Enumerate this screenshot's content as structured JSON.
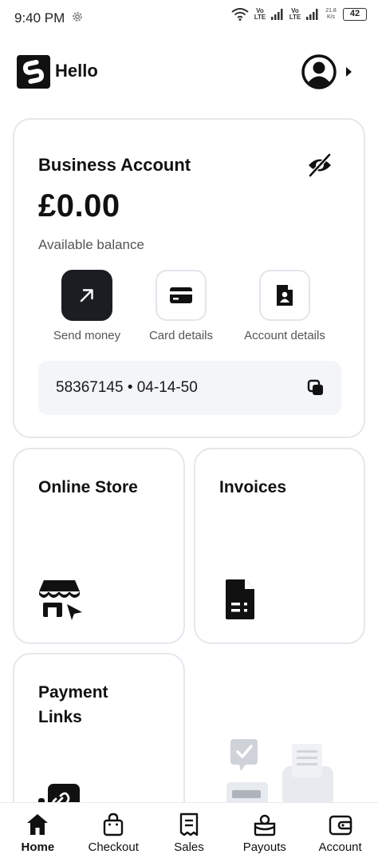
{
  "status_bar": {
    "time": "9:40 PM",
    "network_1": "Vo LTE",
    "network_2": "Vo LTE",
    "speed": "21.8 K/s",
    "battery": "42"
  },
  "header": {
    "greeting": "Hello"
  },
  "account_card": {
    "title": "Business Account",
    "balance": "£0.00",
    "balance_caption": "Available balance",
    "actions": [
      {
        "label": "Send money",
        "icon": "arrow-up-right-icon"
      },
      {
        "label": "Card details",
        "icon": "card-icon"
      },
      {
        "label": "Account details",
        "icon": "document-person-icon"
      }
    ],
    "account_number": "58367145 • 04-14-50"
  },
  "tiles": {
    "online_store": "Online Store",
    "invoices": "Invoices",
    "payment_links": "Payment Links"
  },
  "bottom_nav": [
    {
      "label": "Home",
      "icon": "home-icon",
      "active": true
    },
    {
      "label": "Checkout",
      "icon": "shopping-bag-icon",
      "active": false
    },
    {
      "label": "Sales",
      "icon": "receipt-icon",
      "active": false
    },
    {
      "label": "Payouts",
      "icon": "payout-icon",
      "active": false
    },
    {
      "label": "Account",
      "icon": "wallet-icon",
      "active": false
    }
  ],
  "colors": {
    "primary_dark": "#1a1d21",
    "card_border": "#e4e7ec",
    "muted_bg": "#f3f5f8"
  }
}
